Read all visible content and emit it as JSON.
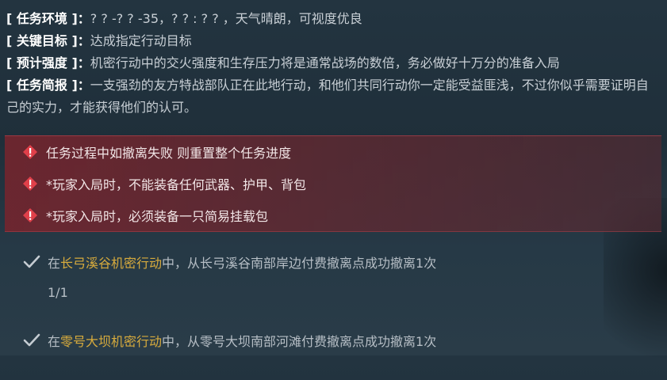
{
  "mission_info": {
    "environment_key": "[ 任务环境 ]：",
    "environment_val": "? ? -? ? -35，? ? : ? ? ，天气晴朗，可视度优良",
    "objective_key": "[ 关键目标 ]：",
    "objective_val": "达成指定行动目标",
    "intensity_key": "[ 预计强度 ]：",
    "intensity_val": "机密行动中的交火强度和生存压力将是通常战场的数倍，务必做好十万分的准备入局",
    "brief_key": "[ 任务简报 ]：",
    "brief_val": "一支强劲的友方特战部队正在此地行动，和他们共同行动你一定能受益匪浅，不过你似乎需要证明自己的实力，才能获得他们的认可。"
  },
  "warnings": [
    "任务过程中如撤离失败 则重置整个任务进度",
    "*玩家入局时，不能装备任何武器、护甲、背包",
    "*玩家入局时，必须装备一只简易挂载包"
  ],
  "tasks": [
    {
      "prefix": "在",
      "highlight": "长弓溪谷机密行动",
      "suffix": "中，从长弓溪谷南部岸边付费撤离点成功撤离1次",
      "progress": "1/1"
    },
    {
      "prefix": "在",
      "highlight": "零号大坝机密行动",
      "suffix": "中，从零号大坝南部河滩付费撤离点成功撤离1次"
    }
  ],
  "colors": {
    "highlight": "#d7ab3d",
    "warning_bg": "#7a2a35",
    "warning_icon": "#e0404a"
  }
}
